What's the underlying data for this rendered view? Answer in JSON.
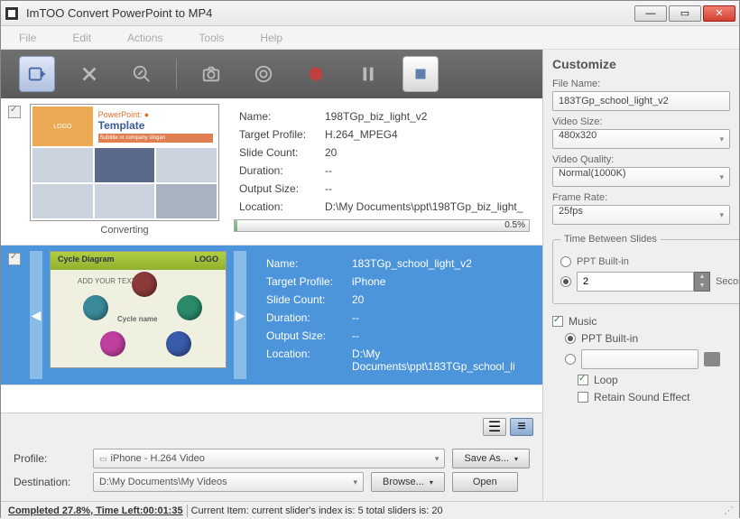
{
  "window": {
    "title": "ImTOO Convert PowerPoint to MP4"
  },
  "menu": [
    "File",
    "Edit",
    "Actions",
    "Tools",
    "Help"
  ],
  "items": [
    {
      "name": "198TGp_biz_light_v2",
      "target_profile": "H.264_MPEG4",
      "slide_count": "20",
      "duration": "--",
      "output_size": "--",
      "location": "D:\\My Documents\\ppt\\198TGp_biz_light_",
      "status": "Converting",
      "progress": "0.5%",
      "thumb_logo": "LOGO",
      "thumb_brand": "PowerPoint:",
      "thumb_title": "Template",
      "thumb_strap": "Subtitle or company slogan"
    },
    {
      "name": "183TGp_school_light_v2",
      "target_profile": "iPhone",
      "slide_count": "20",
      "duration": "--",
      "output_size": "--",
      "location": "D:\\My Documents\\ppt\\183TGp_school_li",
      "thumb_title": "Cycle Diagram",
      "thumb_logo": "LOGO",
      "thumb_hint": "ADD YOUR TEXT",
      "thumb_center": "Cycle name"
    }
  ],
  "labels": {
    "name": "Name:",
    "target_profile": "Target Profile:",
    "slide_count": "Slide Count:",
    "duration": "Duration:",
    "output_size": "Output Size:",
    "location": "Location:"
  },
  "bottom": {
    "profile_label": "Profile:",
    "profile_value": "iPhone - H.264 Video",
    "saveas": "Save As...",
    "destination_label": "Destination:",
    "destination_value": "D:\\My Documents\\My Videos",
    "browse": "Browse...",
    "open": "Open"
  },
  "status": {
    "left": "Completed 27.8%, Time Left:00:01:35",
    "right": "Current Item: current slider's index is: 5 total sliders is: 20"
  },
  "customize": {
    "title": "Customize",
    "file_name_label": "File Name:",
    "file_name": "183TGp_school_light_v2",
    "video_size_label": "Video Size:",
    "video_size": "480x320",
    "video_quality_label": "Video Quality:",
    "video_quality": "Normal(1000K)",
    "frame_rate_label": "Frame Rate:",
    "frame_rate": "25fps",
    "tbs_legend": "Time Between Slides",
    "ppt_builtin": "PPT Built-in",
    "tbs_value": "2",
    "tbs_unit": "Second",
    "music_label": "Music",
    "loop_label": "Loop",
    "retain_label": "Retain Sound Effect"
  }
}
